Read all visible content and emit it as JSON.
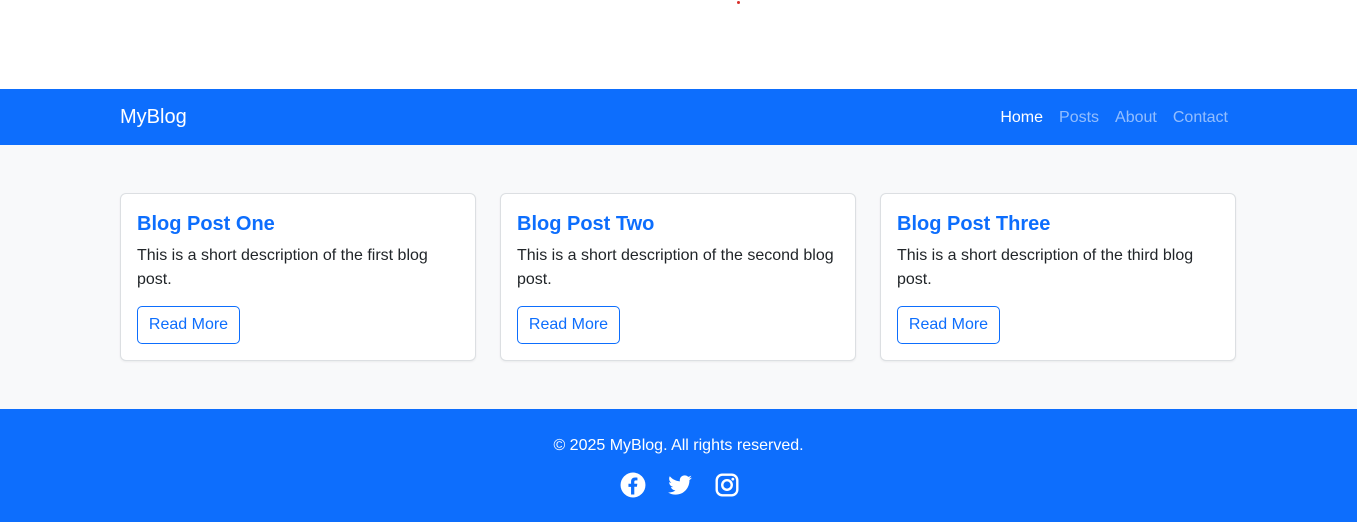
{
  "navbar": {
    "brand": "MyBlog",
    "links": [
      {
        "label": "Home",
        "active": true
      },
      {
        "label": "Posts",
        "active": false
      },
      {
        "label": "About",
        "active": false
      },
      {
        "label": "Contact",
        "active": false
      }
    ]
  },
  "posts": [
    {
      "title": "Blog Post One",
      "description": "This is a short description of the first blog post.",
      "button_label": "Read More"
    },
    {
      "title": "Blog Post Two",
      "description": "This is a short description of the second blog post.",
      "button_label": "Read More"
    },
    {
      "title": "Blog Post Three",
      "description": "This is a short description of the third blog post.",
      "button_label": "Read More"
    }
  ],
  "footer": {
    "copyright": "© 2025 MyBlog. All rights reserved.",
    "social_icons": [
      "facebook-icon",
      "twitter-icon",
      "instagram-icon"
    ]
  },
  "colors": {
    "primary": "#0d6efd",
    "background_light": "#f8f9fa",
    "text": "#212529",
    "nav_muted": "rgba(255,255,255,0.55)"
  }
}
